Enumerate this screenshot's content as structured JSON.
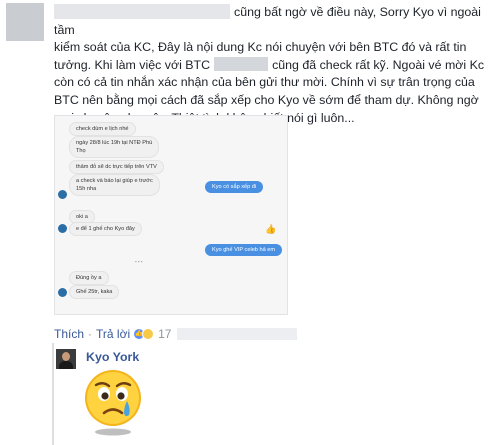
{
  "comment": {
    "line1_suffix": "cũng bất ngờ về điều này, Sorry Kyo vì ngoài tầm",
    "line2": "kiểm soát của KC, Đây là nội dung Kc nói chuyện với bên BTC đó và rất tin",
    "line3_prefix": "tưởng. Khi làm việc với BTC",
    "line3_suffix": "cũng đã check rất kỹ. Ngoài vé mời Kc",
    "line4": "còn có cả tin nhắn xác nhận của bên gửi thư mời. Chính vì sự trân trọng của",
    "line5": "BTC nên bằng mọi cách đã sắp xếp cho Kyo về sớm để tham dự. Không ngờ",
    "line6": "mọi chuyện như vậy. Thiệt tình không biết nói gì luôn..."
  },
  "screenshot_chat": {
    "msg1": "check dùm e lịch nhé",
    "msg2a": "ngày 28/8 lúc 19h tại NTĐ Phú",
    "msg2b": "Thọ",
    "msg3": "thảm đỏ sẽ dc trực tiếp trên VTV",
    "msg4a": "a check và báo lại giúp e trước",
    "msg4b": "15h nha",
    "reply1": "Kyo có sắp xếp đi",
    "msg5": "oki a",
    "msg6": "e để 1 ghế cho Kyo đây",
    "reply2": "Kyo ghế VIP celeb hả em",
    "msg7": "Đúng ồy a",
    "msg8": "Ghế 25tr, kaka"
  },
  "actions": {
    "like": "Thích",
    "separator": "·",
    "reply": "Trả lời",
    "reaction_count": "17",
    "like_icon": "thumbs-up-icon",
    "sad_icon": "sad-face-icon"
  },
  "reply": {
    "author": "Kyo York",
    "sticker": "crying-emoji-sticker"
  },
  "colors": {
    "link": "#385898",
    "text": "#1d2129",
    "muted": "#90949c",
    "messenger_blue": "#4a90e2"
  }
}
